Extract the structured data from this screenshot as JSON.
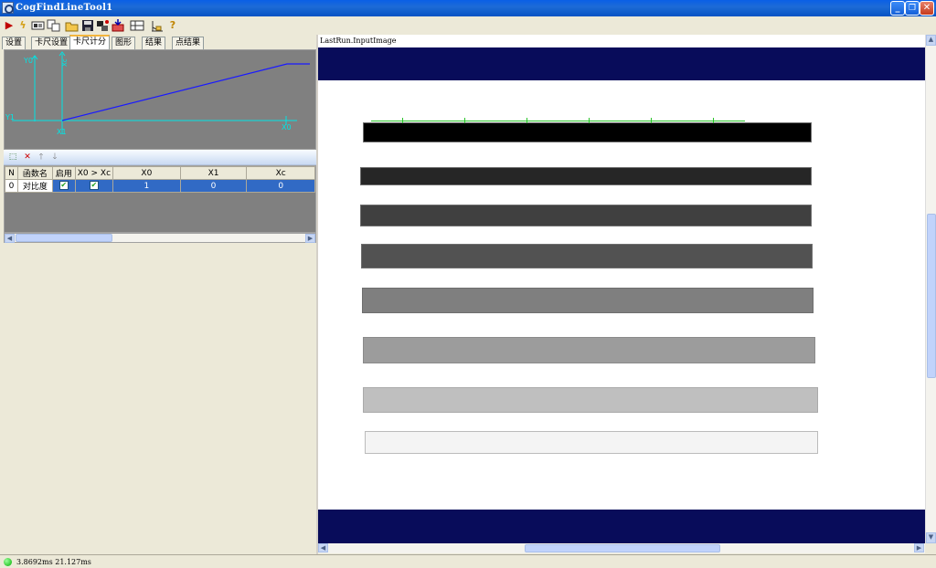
{
  "window": {
    "title": "CogFindLineTool1",
    "minimize": "_",
    "restore": "❐",
    "close": "✕"
  },
  "toolbar": {
    "run_icon": "play-icon",
    "electric_icon": "lightning-icon",
    "help_icon": "question-icon"
  },
  "tabs": [
    "设置",
    "卡尺设置",
    "卡尺计分",
    "图形",
    "结果",
    "点结果"
  ],
  "active_tab": "卡尺计分",
  "graph": {
    "y0_label": "Y0",
    "y1_label": "Y1",
    "x0_label": "X0",
    "x1_label": "X1",
    "xc_label": "Xc",
    "axis_color": "#00e5e5",
    "line_color": "#1a1aff"
  },
  "grid": {
    "columns": [
      "N",
      "函数名",
      "启用",
      "X0 > Xc",
      "X0",
      "X1",
      "Xc"
    ],
    "rows": [
      {
        "n": "0",
        "name": "对比度",
        "enabled": true,
        "x0gtxc": true,
        "x0": "1",
        "x1": "0",
        "xc": "0"
      }
    ]
  },
  "image": {
    "header": "LastRun.InputImage",
    "band_color": "#080c5a",
    "bar_colors": [
      "#000000",
      "#262626",
      "#404040",
      "#525252",
      "#7f7f7f",
      "#9c9c9c",
      "#bfbfbf",
      "#f4f4f4"
    ]
  },
  "status": {
    "text": "3.8692ms  21.127ms"
  }
}
